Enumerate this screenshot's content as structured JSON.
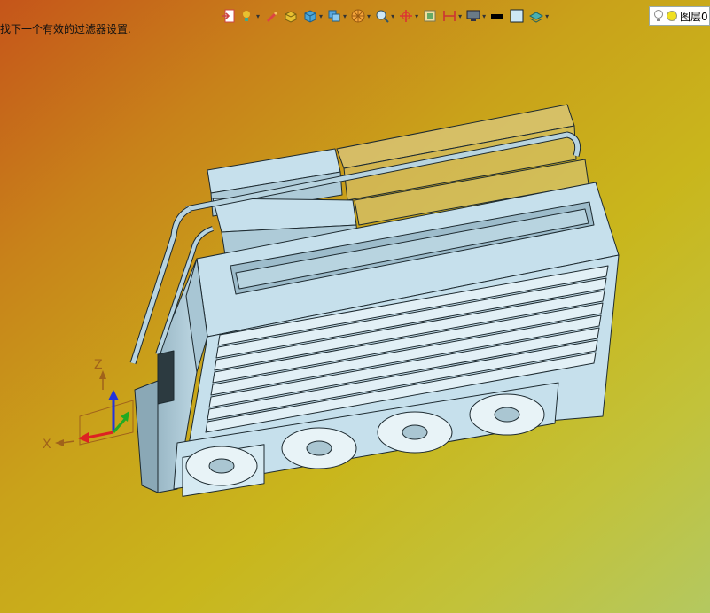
{
  "status": {
    "message": "找下一个有效的过滤器设置."
  },
  "layer": {
    "label": "图层0"
  },
  "axes": {
    "z_label": "Z",
    "x_label": "X"
  },
  "toolbar": {
    "icons": [
      "exit-sketch-icon",
      "bulb-icon",
      "pencil-icon",
      "shaded-cube-icon",
      "solid-cube-icon",
      "view-cube-icon",
      "wheel-icon",
      "magnify-icon",
      "orient-icon",
      "frame-icon",
      "dimension-icon",
      "monitor-icon",
      "black-rect-icon",
      "white-rect-icon",
      "layers-icon"
    ]
  },
  "colors": {
    "bg_top_left": "#c5551a",
    "bg_bottom_right": "#b4c860",
    "model_face": "#c6e0ec",
    "model_edge": "#1d2a30",
    "tray": "#d9c880"
  }
}
